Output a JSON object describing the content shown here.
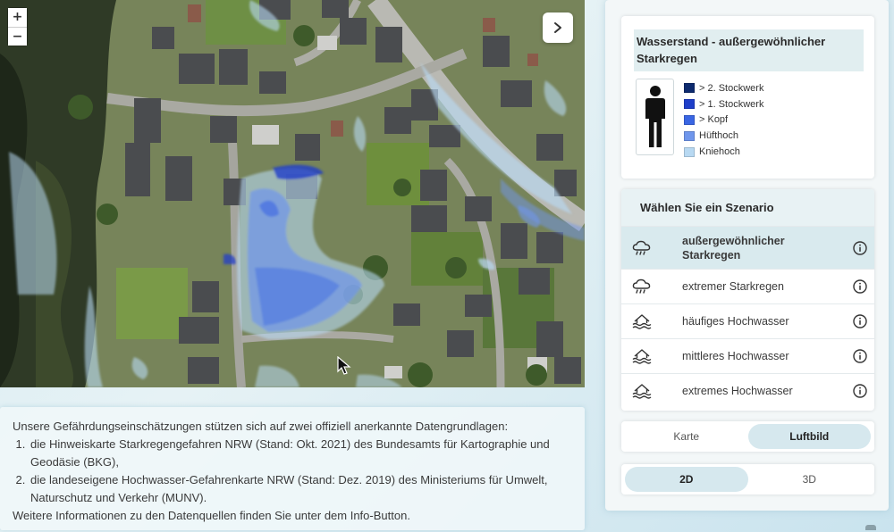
{
  "map": {
    "zoom_in_label": "+",
    "zoom_out_label": "−",
    "expand_icon": "chevron-right-icon"
  },
  "info": {
    "intro": "Unsere Gefährdungseinschätzungen stützen sich auf zwei offiziell anerkannte Datengrundlagen:",
    "sources": [
      "die Hinweiskarte Starkregengefahren NRW (Stand: Okt. 2021) des Bundesamts für Kartographie und Geodäsie (BKG),",
      "die landeseigene Hochwasser-Gefahrenkarte NRW (Stand: Dez. 2019) des Ministeriums für Umwelt, Naturschutz und Verkehr (MUNV)."
    ],
    "outro": "Weitere Informationen zu den Datenquellen finden Sie unter dem Info-Button."
  },
  "legend": {
    "title": "Wasserstand - außergewöhnlicher Starkregen",
    "items": [
      {
        "label": "> 2. Stockwerk",
        "color": "#0d2a6e"
      },
      {
        "label": "> 1. Stockwerk",
        "color": "#1f3fc9"
      },
      {
        "label": "> Kopf",
        "color": "#3a66e3"
      },
      {
        "label": "Hüfthoch",
        "color": "#6f96ec"
      },
      {
        "label": "Kniehoch",
        "color": "#b8d9f2"
      }
    ]
  },
  "scenarios": {
    "header": "Wählen Sie ein Szenario",
    "items": [
      {
        "label": "außergewöhnlicher Starkregen",
        "icon": "rain-cloud-icon",
        "active": true
      },
      {
        "label": "extremer Starkregen",
        "icon": "rain-cloud-icon",
        "active": false
      },
      {
        "label": "häufiges Hochwasser",
        "icon": "flood-house-icon",
        "active": false
      },
      {
        "label": "mittleres Hochwasser",
        "icon": "flood-house-icon",
        "active": false
      },
      {
        "label": "extremes Hochwasser",
        "icon": "flood-house-icon",
        "active": false
      }
    ]
  },
  "basemap_toggle": {
    "options": [
      "Karte",
      "Luftbild"
    ],
    "selected": "Luftbild"
  },
  "view_toggle": {
    "options": [
      "2D",
      "3D"
    ],
    "selected": "2D"
  },
  "colors": {
    "accent": "#d6e8ee",
    "panel": "#f3f7f8"
  }
}
